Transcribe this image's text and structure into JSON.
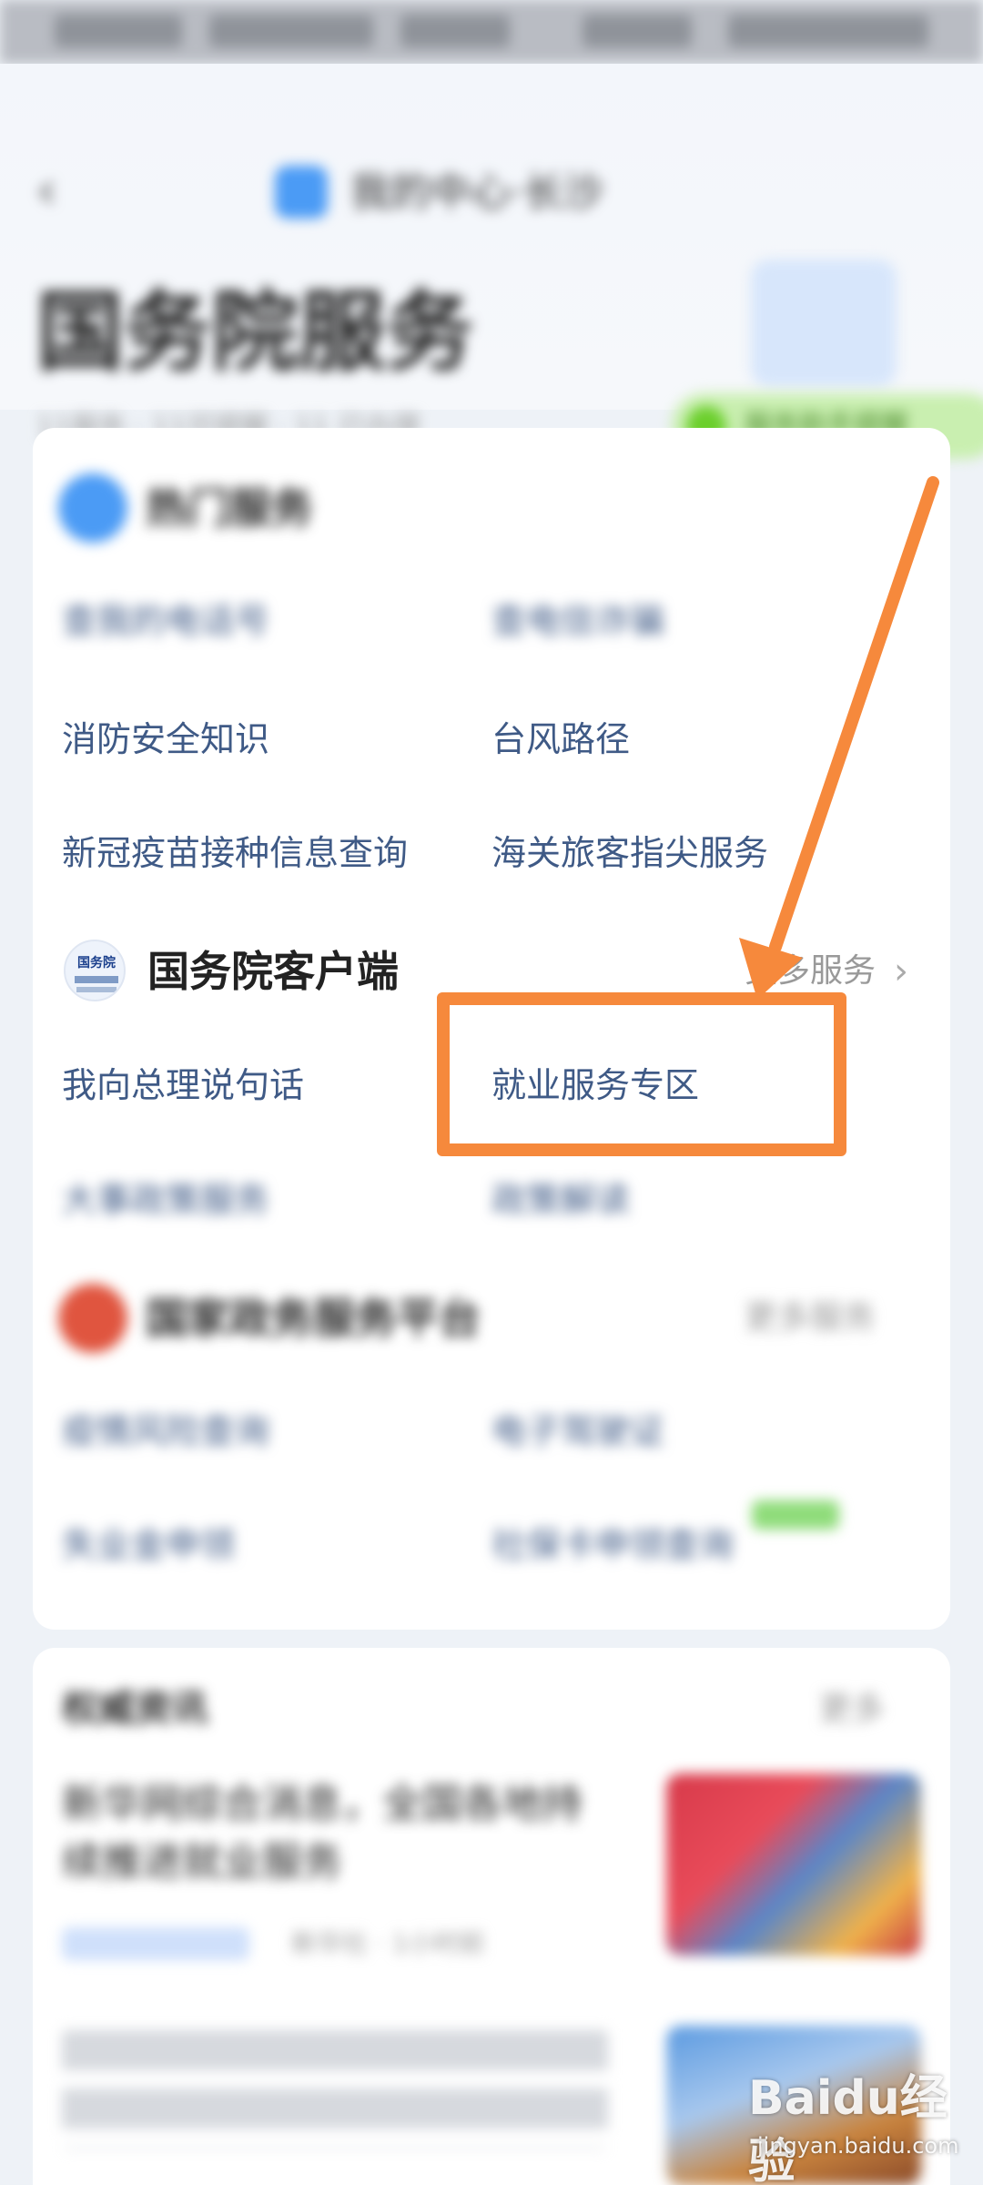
{
  "header": {
    "city_title": "我的中心·长沙",
    "page_title": "国务院服务",
    "sub_info": "11服务 · 11可提醒 · 11 已办理",
    "badge_text": "服务助手提醒"
  },
  "section_top": {
    "title": "热门服务",
    "items": [
      {
        "label": "查我的电话号"
      },
      {
        "label": "查电信诈骗"
      },
      {
        "label": "消防安全知识"
      },
      {
        "label": "台风路径"
      },
      {
        "label": "新冠疫苗接种信息查询"
      },
      {
        "label": "海关旅客指尖服务"
      }
    ]
  },
  "section_gov": {
    "title": "国务院客户端",
    "more": "更多服务",
    "items": [
      {
        "label": "我向总理说句话"
      },
      {
        "label": "就业服务专区"
      },
      {
        "label": "大事政策服务"
      },
      {
        "label": "政策解读"
      }
    ]
  },
  "section_platform": {
    "title": "国家政务服务平台",
    "more": "更多服务",
    "items": [
      {
        "label": "疫情风险查询"
      },
      {
        "label": "电子驾驶证"
      },
      {
        "label": "失业金申领"
      },
      {
        "label": "社保卡申领查询"
      }
    ]
  },
  "news": {
    "title": "权威资讯",
    "more": "更多",
    "item1_title": "新华网综合消息，全国各地持续推进就业服务",
    "item1_meta": "新华社 · 1小时前"
  },
  "watermark": {
    "brand": "Baidu经验",
    "url": "jingyan.baidu.com"
  },
  "colors": {
    "annotation": "#f6893c",
    "link": "#3f5a86"
  }
}
